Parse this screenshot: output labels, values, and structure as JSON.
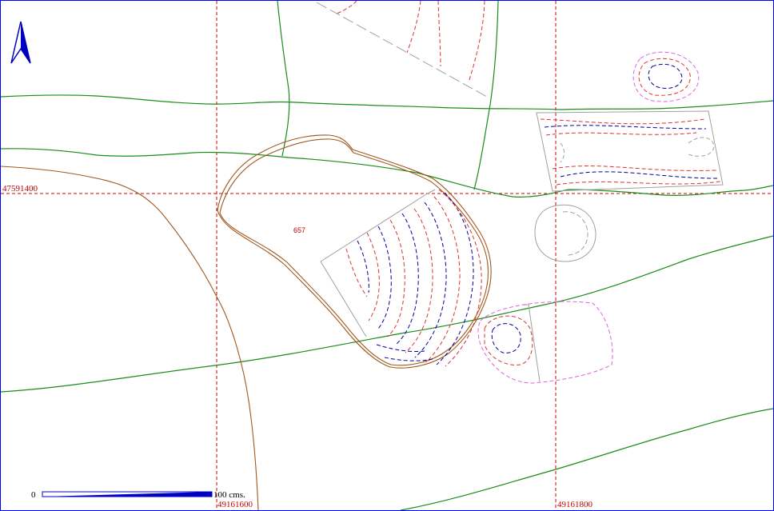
{
  "map": {
    "grid": {
      "easting_labels": [
        "49161600",
        "49161800"
      ],
      "northing_labels": [
        "47591400"
      ]
    },
    "feature_label": "657",
    "scale_bar": {
      "start_label": "0",
      "end_label": "100",
      "unit_label": "cms."
    },
    "north_arrow_icon": "north-arrow-icon"
  },
  "colors": {
    "frame": "#0000ff",
    "grid_lines": "#d00000",
    "grid_labels": "#c00000",
    "green_boundary": "#1a8c1a",
    "brown_cut": "#a0581e",
    "contour_blue": "#0000a0",
    "contour_red": "#e03030",
    "contour_pink": "#e060e0",
    "sketch_grey": "#a0a0a0",
    "north_arrow": "#0000c0"
  }
}
